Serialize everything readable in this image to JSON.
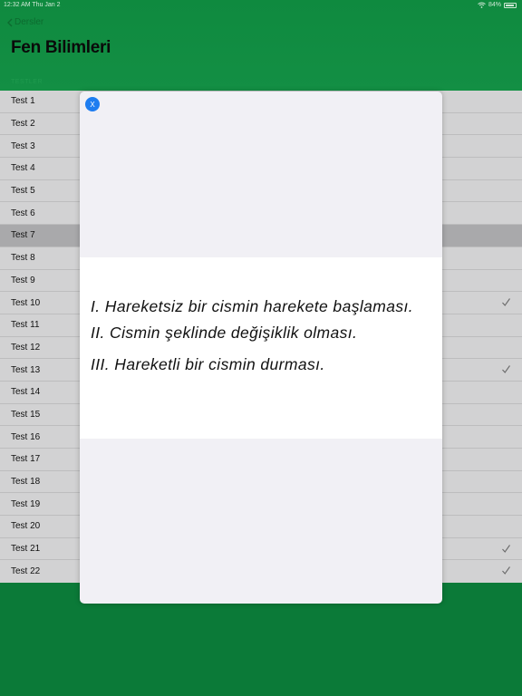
{
  "status_bar": {
    "time": "12:32 AM   Thu Jan 2",
    "battery": "84%"
  },
  "header": {
    "back_label": "Dersler",
    "title": "Fen Bilimleri",
    "section_label": "TESTLER"
  },
  "tests": [
    {
      "label": "Test 1",
      "checked": false
    },
    {
      "label": "Test 2",
      "checked": false
    },
    {
      "label": "Test 3",
      "checked": false
    },
    {
      "label": "Test 4",
      "checked": false
    },
    {
      "label": "Test 5",
      "checked": false
    },
    {
      "label": "Test 6",
      "checked": false
    },
    {
      "label": "Test 7",
      "checked": false,
      "selected": true
    },
    {
      "label": "Test 8",
      "checked": false
    },
    {
      "label": "Test 9",
      "checked": false
    },
    {
      "label": "Test 10",
      "checked": true
    },
    {
      "label": "Test 11",
      "checked": false
    },
    {
      "label": "Test 12",
      "checked": false
    },
    {
      "label": "Test 13",
      "checked": true
    },
    {
      "label": "Test 14",
      "checked": false
    },
    {
      "label": "Test 15",
      "checked": false
    },
    {
      "label": "Test 16",
      "checked": false
    },
    {
      "label": "Test 17",
      "checked": false
    },
    {
      "label": "Test 18",
      "checked": false
    },
    {
      "label": "Test 19",
      "checked": false
    },
    {
      "label": "Test 20",
      "checked": false
    },
    {
      "label": "Test 21",
      "checked": true
    },
    {
      "label": "Test 22",
      "checked": true
    }
  ],
  "modal": {
    "close_label": "X",
    "question_lines": [
      "I. Hareketsiz bir cismin harekete başlaması.",
      "II. Cismin şeklinde değişiklik olması.",
      "III. Hareketli bir cismin durması."
    ]
  },
  "colors": {
    "brand_green": "#0b7a38",
    "close_button": "#1e7df0",
    "selected_row": "#a9a9ab"
  }
}
